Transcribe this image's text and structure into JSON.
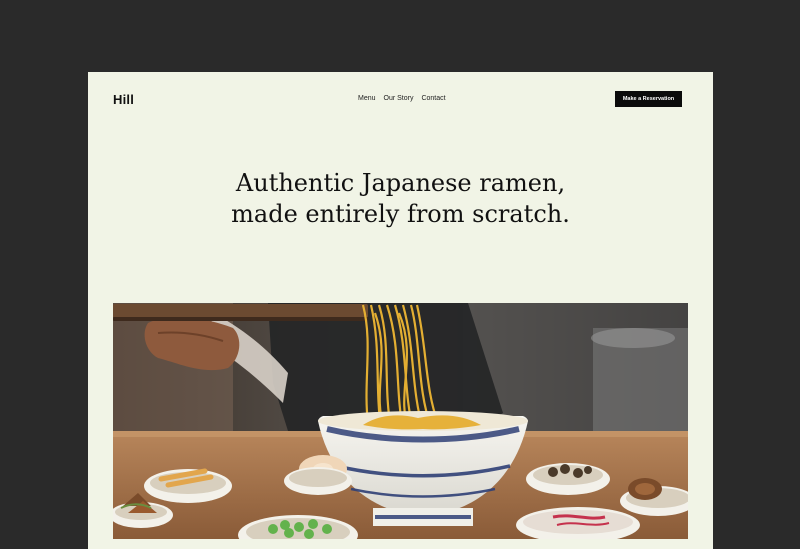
{
  "brand": "Hill",
  "nav": {
    "items": [
      "Menu",
      "Our Story",
      "Contact"
    ]
  },
  "cta_label": "Make a Reservation",
  "hero": {
    "headline_line1": "Authentic Japanese ramen,",
    "headline_line2": "made entirely from scratch."
  },
  "colors": {
    "outer_background": "#2a2a2a",
    "page_background": "#f1f4e6",
    "text": "#111111",
    "button": "#0b0b0b"
  },
  "image": {
    "subject": "bowl-of-ramen-with-noodles-lifted-by-chopsticks"
  }
}
